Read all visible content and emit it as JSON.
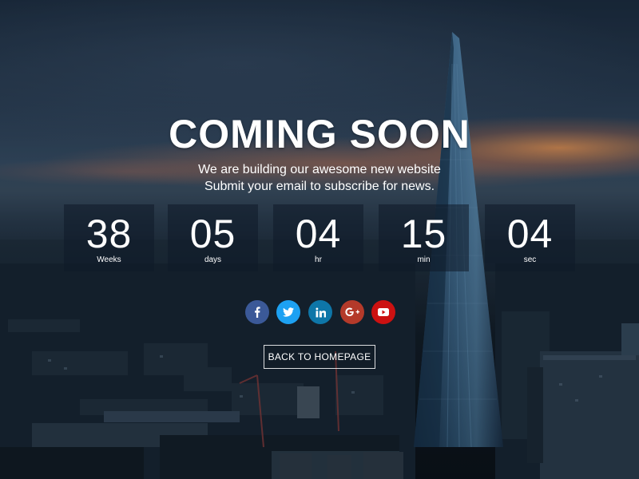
{
  "page": {
    "title": "COMING SOON",
    "subtitle_lines": [
      "We are building our awesome new website",
      "Submit your email to subscribe for news."
    ]
  },
  "countdown": [
    {
      "value": "38",
      "label": "Weeks"
    },
    {
      "value": "05",
      "label": "days"
    },
    {
      "value": "04",
      "label": "hr"
    },
    {
      "value": "15",
      "label": "min"
    },
    {
      "value": "04",
      "label": "sec"
    }
  ],
  "social": [
    {
      "icon": "facebook-icon",
      "color": "#3b5998"
    },
    {
      "icon": "twitter-icon",
      "color": "#1da1f2"
    },
    {
      "icon": "linkedin-icon",
      "color": "#0e76a8"
    },
    {
      "icon": "google-plus-icon",
      "color": "#b43a2a"
    },
    {
      "icon": "youtube-icon",
      "color": "#cc1111"
    }
  ],
  "back_button": {
    "label": "BACK TO HOMEPAGE"
  },
  "colors": {
    "text": "#ffffff",
    "box_bg": "rgba(15,26,40,0.55)"
  }
}
